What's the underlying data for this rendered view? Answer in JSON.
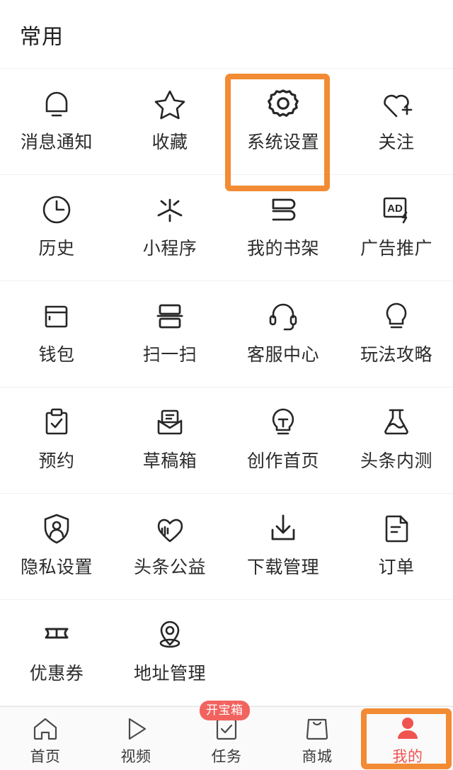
{
  "section": {
    "title": "常用"
  },
  "colors": {
    "highlight_orange": "#f28b34",
    "accent_red": "#f0534f",
    "badge_red": "#f2635f",
    "icon_stroke": "#262626",
    "label_text": "#2b2b2b",
    "page_background": "#ffffff",
    "nav_background": "#fafafa",
    "divider": "#f0f0f0"
  },
  "grid": {
    "columns": 4,
    "rows": [
      [
        {
          "label": "消息通知",
          "icon": "bell-icon"
        },
        {
          "label": "收藏",
          "icon": "star-icon"
        },
        {
          "label": "系统设置",
          "icon": "gear-icon",
          "highlighted": true
        },
        {
          "label": "关注",
          "icon": "heart-plus-icon"
        }
      ],
      [
        {
          "label": "历史",
          "icon": "clock-icon"
        },
        {
          "label": "小程序",
          "icon": "mini-program-icon"
        },
        {
          "label": "我的书架",
          "icon": "bookshelf-icon"
        },
        {
          "label": "广告推广",
          "icon": "ad-promotion-icon"
        }
      ],
      [
        {
          "label": "钱包",
          "icon": "wallet-icon"
        },
        {
          "label": "扫一扫",
          "icon": "scan-icon"
        },
        {
          "label": "客服中心",
          "icon": "headset-icon"
        },
        {
          "label": "玩法攻略",
          "icon": "lightbulb-icon"
        }
      ],
      [
        {
          "label": "预约",
          "icon": "clipboard-check-icon"
        },
        {
          "label": "草稿箱",
          "icon": "envelope-icon"
        },
        {
          "label": "创作首页",
          "icon": "bulb-text-icon"
        },
        {
          "label": "头条内测",
          "icon": "flask-icon"
        }
      ],
      [
        {
          "label": "隐私设置",
          "icon": "shield-person-icon"
        },
        {
          "label": "头条公益",
          "icon": "heart-chart-icon"
        },
        {
          "label": "下载管理",
          "icon": "download-icon"
        },
        {
          "label": "订单",
          "icon": "document-icon"
        }
      ],
      [
        {
          "label": "优惠券",
          "icon": "coupon-icon"
        },
        {
          "label": "地址管理",
          "icon": "location-pin-icon"
        },
        {
          "label": "",
          "icon": ""
        },
        {
          "label": "",
          "icon": ""
        }
      ]
    ]
  },
  "bottom_nav": {
    "items": [
      {
        "label": "首页",
        "icon": "home-icon",
        "active": false
      },
      {
        "label": "视频",
        "icon": "play-icon",
        "active": false
      },
      {
        "label": "任务",
        "icon": "task-check-icon",
        "active": false,
        "badge": "开宝箱"
      },
      {
        "label": "商城",
        "icon": "shopping-bag-icon",
        "active": false
      },
      {
        "label": "我的",
        "icon": "person-filled-icon",
        "active": true,
        "highlighted": true
      }
    ]
  }
}
